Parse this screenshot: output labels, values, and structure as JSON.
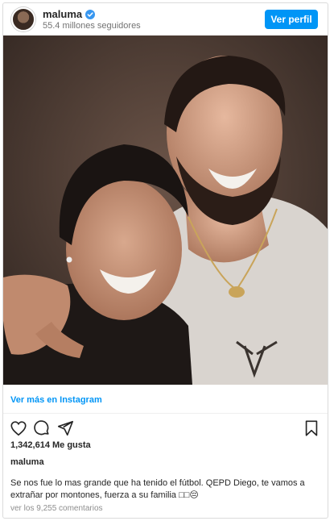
{
  "header": {
    "username": "maluma",
    "followers": "55.4 millones seguidores",
    "view_profile_label": "Ver perfil",
    "verified_icon": "verified-badge-icon",
    "accent_color": "#0095f6"
  },
  "media": {
    "description_icon": "post-photo"
  },
  "footer": {
    "ver_mas": "Ver más en Instagram",
    "actions": [
      "heart-icon",
      "comment-icon",
      "share-icon",
      "bookmark-icon"
    ],
    "likes": "1,342,614 Me gusta",
    "owner": "maluma",
    "caption": "Se nos fue lo mas grande que ha tenido el fútbol. QEPD Diego, te vamos a extrañar por montones, fuerza a su familia □□😔",
    "comments": "ver los 9,255 comentarios"
  }
}
